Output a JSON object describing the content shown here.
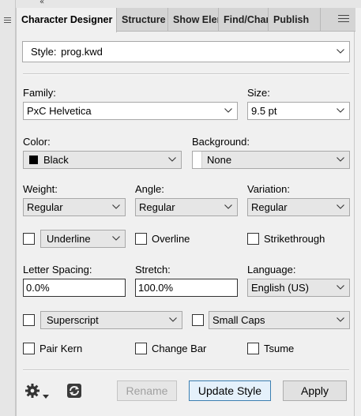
{
  "window": {
    "collapse_glyph": "«"
  },
  "tabs": [
    {
      "label": "Character Designer",
      "active": true
    },
    {
      "label": "Structure",
      "active": false
    },
    {
      "label": "Show Elements",
      "active": false
    },
    {
      "label": "Find/Change",
      "active": false
    },
    {
      "label": "Publish",
      "active": false
    }
  ],
  "style_row": {
    "label": "Style:",
    "value": "prog.kwd"
  },
  "family": {
    "label": "Family:",
    "value": "PxC Helvetica"
  },
  "size": {
    "label": "Size:",
    "value": "9.5 pt"
  },
  "color": {
    "label": "Color:",
    "value": "Black",
    "swatch": "#000000"
  },
  "background": {
    "label": "Background:",
    "value": "None"
  },
  "weight": {
    "label": "Weight:",
    "value": "Regular"
  },
  "angle": {
    "label": "Angle:",
    "value": "Regular"
  },
  "variation": {
    "label": "Variation:",
    "value": "Regular"
  },
  "underline": {
    "value": "Underline"
  },
  "overline": {
    "label": "Overline"
  },
  "strikethrough": {
    "label": "Strikethrough"
  },
  "letter_spacing": {
    "label": "Letter Spacing:",
    "value": "0.0%"
  },
  "stretch": {
    "label": "Stretch:",
    "value": "100.0%"
  },
  "language": {
    "label": "Language:",
    "value": "English (US)"
  },
  "superscript": {
    "value": "Superscript"
  },
  "small_caps": {
    "value": "Small Caps"
  },
  "pair_kern": {
    "label": "Pair Kern"
  },
  "change_bar": {
    "label": "Change Bar"
  },
  "tsume": {
    "label": "Tsume"
  },
  "buttons": {
    "rename": "Rename",
    "update_style": "Update Style",
    "apply": "Apply"
  },
  "icons": {
    "settings": "gear-icon",
    "refresh": "refresh-icon",
    "panel_menu": "hamburger-menu-icon"
  },
  "colors": {
    "focus_border": "#3c7fb1",
    "focus_bg": "#e5f1fb",
    "panel_bg": "#f0f0f0",
    "tab_bar_bg": "#d4d4d4"
  }
}
